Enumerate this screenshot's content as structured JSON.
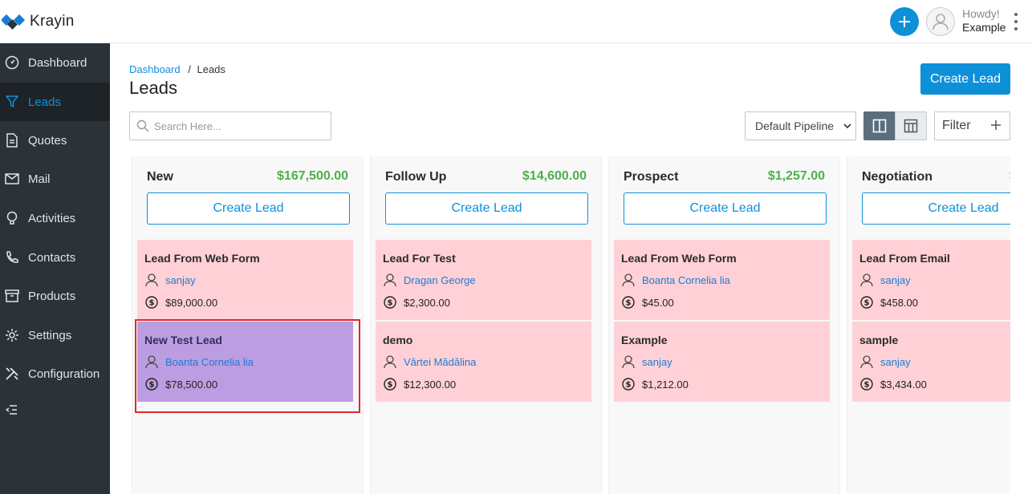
{
  "app": {
    "name": "Krayin"
  },
  "header": {
    "greeting": "Howdy!",
    "username": "Example"
  },
  "sidebar": {
    "items": [
      {
        "label": "Dashboard",
        "icon": "dashboard-icon"
      },
      {
        "label": "Leads",
        "icon": "filter-icon",
        "active": true
      },
      {
        "label": "Quotes",
        "icon": "document-icon"
      },
      {
        "label": "Mail",
        "icon": "mail-icon"
      },
      {
        "label": "Activities",
        "icon": "lightbulb-icon"
      },
      {
        "label": "Contacts",
        "icon": "phone-icon"
      },
      {
        "label": "Products",
        "icon": "archive-box-icon"
      },
      {
        "label": "Settings",
        "icon": "gear-icon"
      },
      {
        "label": "Configuration",
        "icon": "tools-icon"
      }
    ]
  },
  "breadcrumb": {
    "root": "Dashboard",
    "separator": "/",
    "current": "Leads"
  },
  "page": {
    "title": "Leads",
    "create_label": "Create Lead"
  },
  "search": {
    "placeholder": "Search Here..."
  },
  "toolbar": {
    "pipeline": "Default Pipeline",
    "filter_label": "Filter"
  },
  "colors": {
    "accent": "#0e90d9",
    "sidebar": "#2b3238",
    "card": "#ffd1d6",
    "card_selected": "#bd9de1",
    "total": "#4bb14b"
  },
  "columns": [
    {
      "name": "New",
      "total": "$167,500.00",
      "create_label": "Create Lead",
      "cards": [
        {
          "title": "Lead From Web Form",
          "person": "sanjay",
          "amount": "$89,000.00"
        },
        {
          "title": "New Test Lead",
          "person": "Boanta Cornelia lia",
          "amount": "$78,500.00",
          "selected": true
        }
      ]
    },
    {
      "name": "Follow Up",
      "total": "$14,600.00",
      "create_label": "Create Lead",
      "cards": [
        {
          "title": "Lead For Test",
          "person": "Dragan George",
          "amount": "$2,300.00"
        },
        {
          "title": "demo",
          "person": "Vârtei Mădălina",
          "amount": "$12,300.00"
        }
      ]
    },
    {
      "name": "Prospect",
      "total": "$1,257.00",
      "create_label": "Create Lead",
      "cards": [
        {
          "title": "Lead From Web Form",
          "person": "Boanta Cornelia lia",
          "amount": "$45.00"
        },
        {
          "title": "Example",
          "person": "sanjay",
          "amount": "$1,212.00"
        }
      ]
    },
    {
      "name": "Negotiation",
      "total": "$",
      "create_label": "Create Lead",
      "cards": [
        {
          "title": "Lead From Email",
          "person": "sanjay",
          "amount": "$458.00"
        },
        {
          "title": "sample",
          "person": "sanjay",
          "amount": "$3,434.00"
        }
      ]
    }
  ]
}
